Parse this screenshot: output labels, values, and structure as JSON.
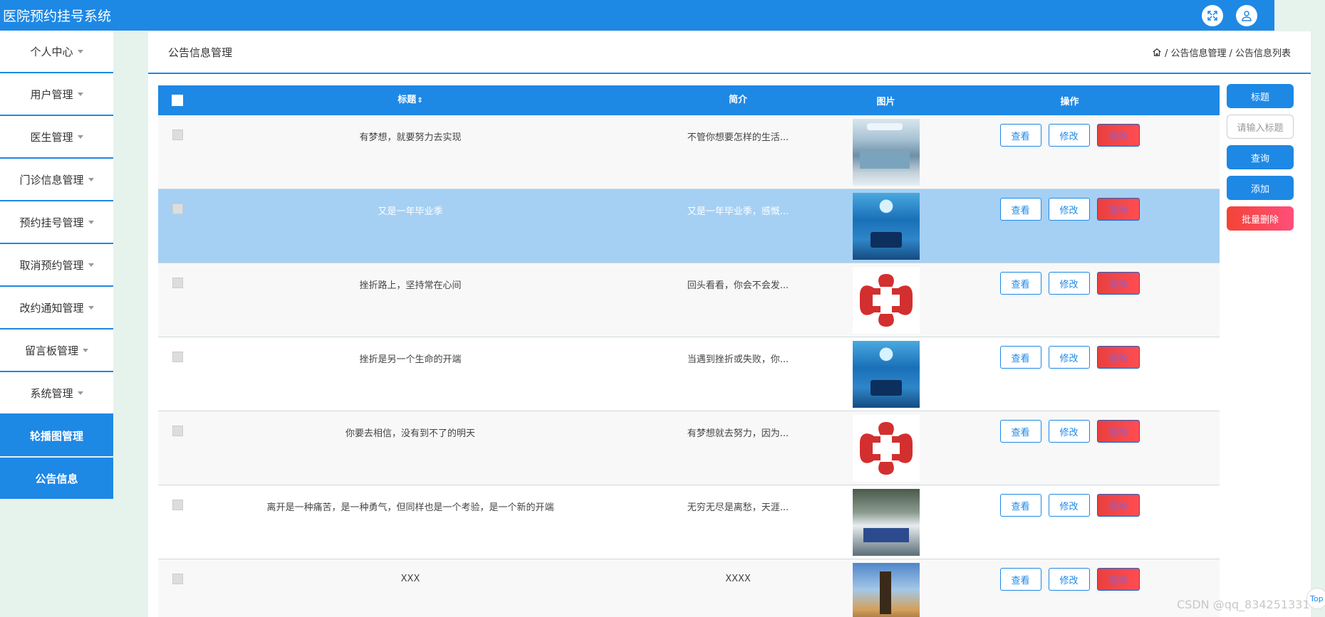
{
  "app": {
    "title": "医院预约挂号系统"
  },
  "topbar": {
    "fullscreen_icon": "expand-icon",
    "user_icon": "user-icon"
  },
  "sidebar": {
    "items": [
      {
        "label": "个人中心",
        "caret": true,
        "active": false
      },
      {
        "label": "用户管理",
        "caret": true,
        "active": false
      },
      {
        "label": "医生管理",
        "caret": true,
        "active": false
      },
      {
        "label": "门诊信息管理",
        "caret": true,
        "active": false
      },
      {
        "label": "预约挂号管理",
        "caret": true,
        "active": false
      },
      {
        "label": "取消预约管理",
        "caret": true,
        "active": false
      },
      {
        "label": "改约通知管理",
        "caret": true,
        "active": false
      },
      {
        "label": "留言板管理",
        "caret": true,
        "active": false
      },
      {
        "label": "系统管理",
        "caret": true,
        "active": false
      },
      {
        "label": "轮播图管理",
        "caret": false,
        "active": true
      },
      {
        "label": "公告信息",
        "caret": false,
        "active": true
      }
    ]
  },
  "header": {
    "title": "公告信息管理",
    "breadcrumb": [
      "/ 公告信息管理",
      "/ 公告信息列表"
    ]
  },
  "table": {
    "columns": {
      "title": "标题",
      "brief": "简介",
      "picture": "图片",
      "ops": "操作"
    },
    "rows": [
      {
        "title": "有梦想，就要努力去实现",
        "brief": "不管你想要怎样的生活...",
        "pic": "or",
        "selected": false
      },
      {
        "title": "又是一年毕业季",
        "brief": "又是一年毕业季，感慨...",
        "pic": "or2",
        "selected": true
      },
      {
        "title": "挫折路上，坚持常在心间",
        "brief": "回头看看，你会不会发...",
        "pic": "redcross",
        "selected": false
      },
      {
        "title": "挫折是另一个生命的开端",
        "brief": "当遇到挫折或失败，你...",
        "pic": "or2",
        "selected": false
      },
      {
        "title": "你要去相信，没有到不了的明天",
        "brief": "有梦想就去努力，因为...",
        "pic": "redcross",
        "selected": false
      },
      {
        "title": "离开是一种痛苦，是一种勇气，但同样也是一个考验，是一个新的开端",
        "brief": "无穷无尽是离愁，天涯...",
        "pic": "hall",
        "selected": false
      },
      {
        "title": "XXX",
        "brief": "XXXX",
        "pic": "castle",
        "selected": false
      }
    ],
    "row_buttons": {
      "view": "查看",
      "edit": "修改",
      "delete": "删除"
    }
  },
  "right_panel": {
    "title_label": "标题",
    "search_placeholder": "请输入标题",
    "query": "查询",
    "add": "添加",
    "batch_delete": "批量删除"
  },
  "colors": {
    "primary": "#1e88e5",
    "selected_row": "#a5d0f3",
    "danger": "#f44336"
  },
  "watermark": "CSDN @qq_834251331",
  "to_top": "Top"
}
